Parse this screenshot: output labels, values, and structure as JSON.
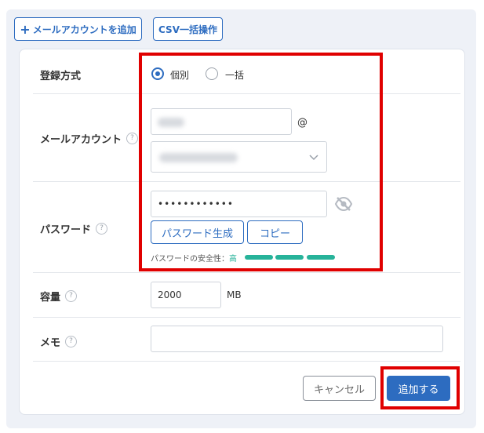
{
  "toolbar": {
    "add_account_label": "メールアカウントを追加",
    "csv_label": "CSV一括操作"
  },
  "form": {
    "registration": {
      "label": "登録方式",
      "options": [
        {
          "label": "個別",
          "selected": true
        },
        {
          "label": "一括",
          "selected": false
        }
      ]
    },
    "mail_account": {
      "label": "メールアカウント",
      "at_sign": "@"
    },
    "password": {
      "label": "パスワード",
      "value": "••••••••••••",
      "generate_label": "パスワード生成",
      "copy_label": "コピー",
      "strength_label": "パスワードの安全性：",
      "strength_value": "高"
    },
    "capacity": {
      "label": "容量",
      "value": "2000",
      "unit": "MB"
    },
    "memo": {
      "label": "メモ",
      "value": ""
    }
  },
  "actions": {
    "cancel_label": "キャンセル",
    "submit_label": "追加する"
  },
  "colors": {
    "accent": "#2d6cc0",
    "highlight": "#e00000",
    "strength": "#27b39a"
  }
}
